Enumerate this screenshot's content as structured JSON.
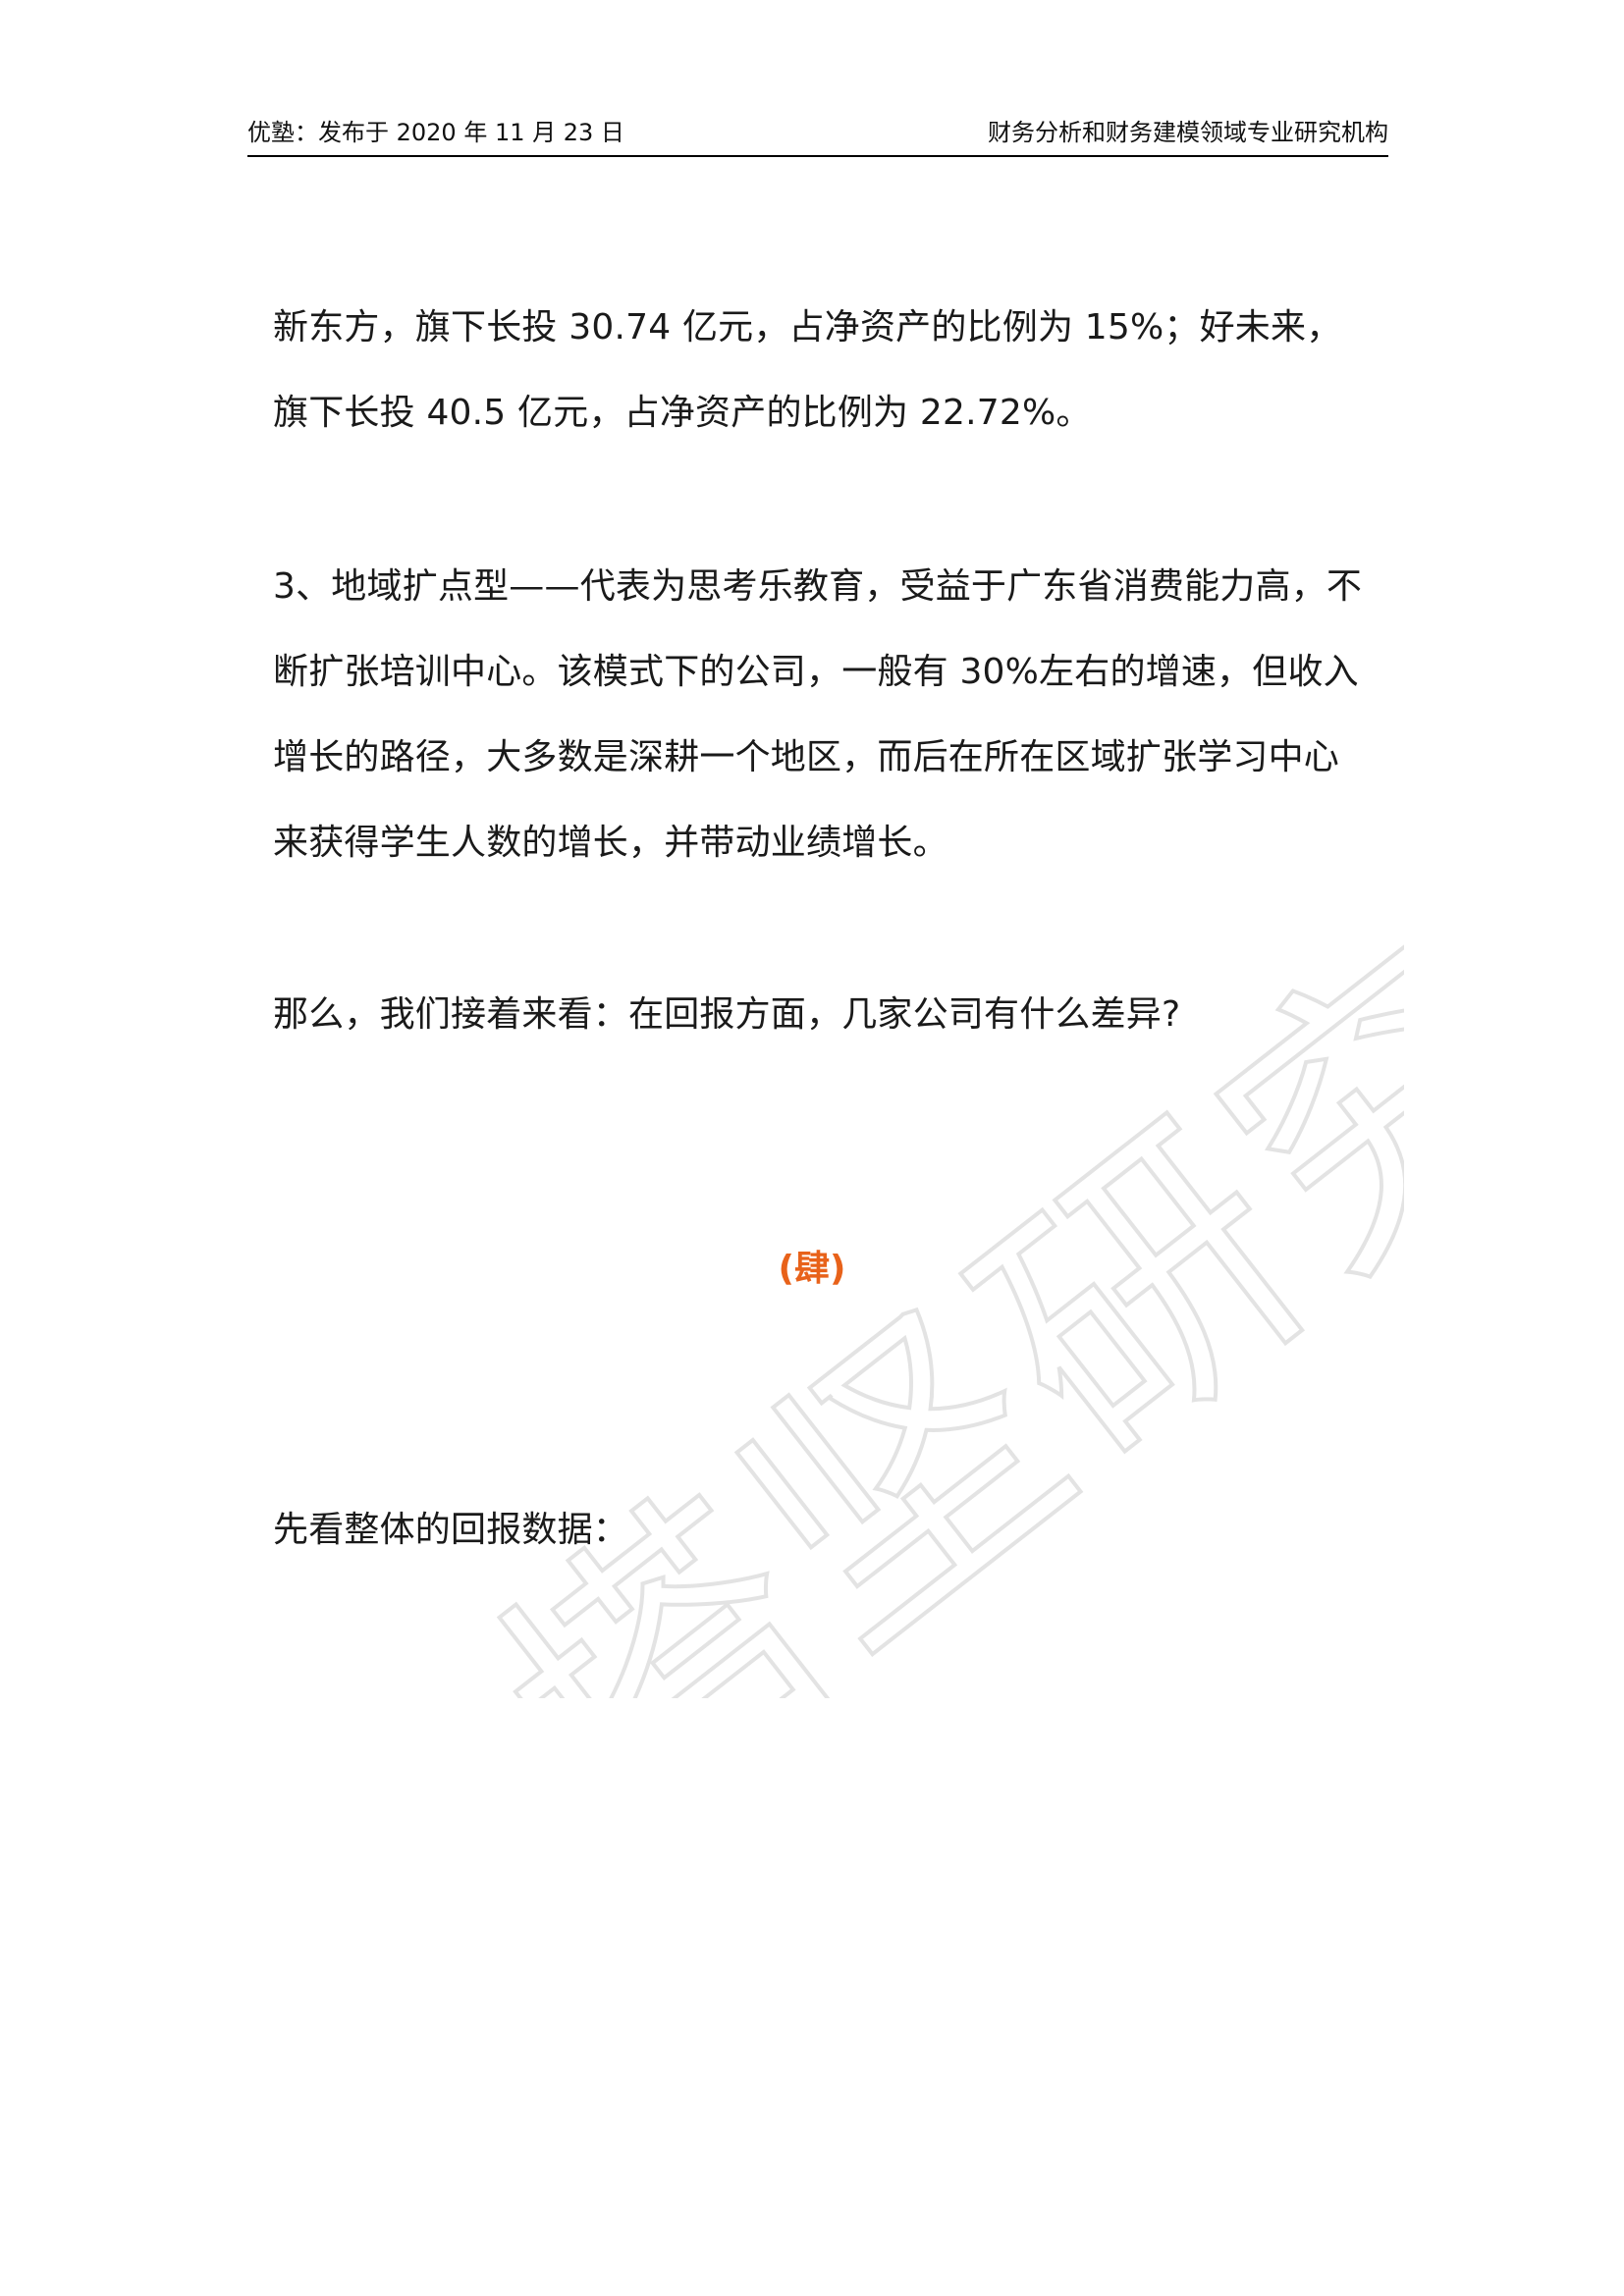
{
  "header": {
    "left": "优塾：发布于 2020 年 11 月 23 日",
    "right": "财务分析和财务建模领域专业研究机构"
  },
  "paragraphs": {
    "p1": "新东方，旗下长投 30.74 亿元，占净资产的比例为 15%；好未来，旗下长投 40.5 亿元，占净资产的比例为 22.72%。",
    "p2": "3、地域扩点型——代表为思考乐教育，受益于广东省消费能力高，不断扩张培训中心。该模式下的公司，一般有 30%左右的增速，但收入增长的路径，大多数是深耕一个地区，而后在所在区域扩张学习中心来获得学生人数的增长，并带动业绩增长。",
    "p3": "那么，我们接着来看：在回报方面，几家公司有什么差异?",
    "p4": "先看整体的回报数据："
  },
  "section_mark": "(肆)",
  "watermark": {
    "text": "塔坚研究",
    "color": "#e6e6e6"
  }
}
